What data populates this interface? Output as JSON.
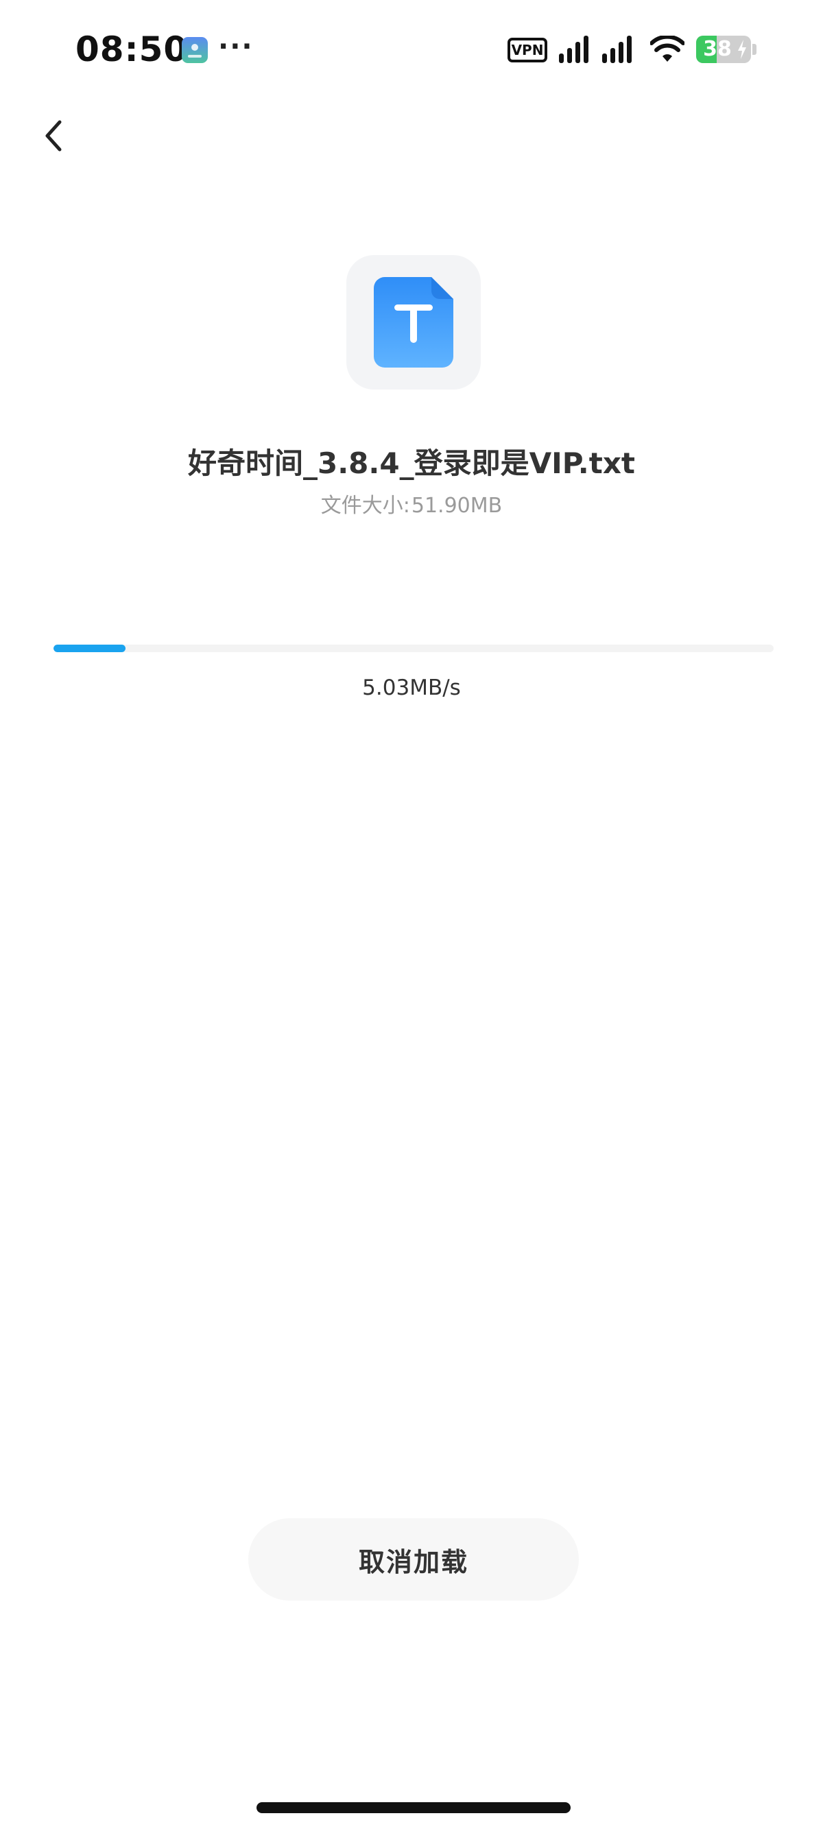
{
  "status_bar": {
    "time": "08:50",
    "more": "···",
    "vpn_label": "VPN",
    "battery_text": "38",
    "battery_percent": 38
  },
  "icons": {
    "back": "chevron-left-icon",
    "file_type": "txt-file-icon"
  },
  "file": {
    "name": "好奇时间_3.8.4_登录即是VIP.txt",
    "size_label": "文件大小:",
    "size_value": "51.90MB"
  },
  "download": {
    "progress_fraction": 0.1,
    "speed": "5.03MB/s"
  },
  "actions": {
    "cancel_label": "取消加载"
  },
  "colors": {
    "accent": "#1aa3ef",
    "file_icon": "#2f8ef7",
    "battery": "#3cc860"
  }
}
